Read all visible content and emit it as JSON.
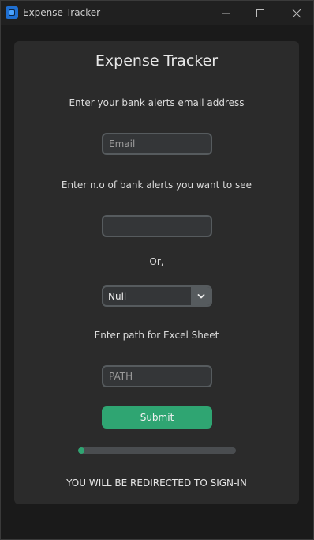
{
  "window": {
    "title": "Expense Tracker"
  },
  "form": {
    "heading": "Expense Tracker",
    "email_label": "Enter your bank alerts email address",
    "email_placeholder": "Email",
    "email_value": "",
    "count_label": "Enter n.o of bank alerts you want to see",
    "count_value": "",
    "or_label": "Or,",
    "dropdown_selected": "Null",
    "path_label": "Enter path for Excel Sheet",
    "path_placeholder": "PATH",
    "path_value": "",
    "submit_label": "Submit",
    "progress_fraction": 0.04,
    "redirect_message": "YOU WILL BE REDIRECTED TO SIGN-IN"
  },
  "colors": {
    "accent": "#2fa572",
    "panel": "#2b2b2b",
    "background": "#1a1a1a"
  },
  "icons": {
    "app": "app-icon",
    "minimize": "minimize-icon",
    "maximize": "maximize-icon",
    "close": "close-icon",
    "dropdown": "chevron-down-icon"
  }
}
